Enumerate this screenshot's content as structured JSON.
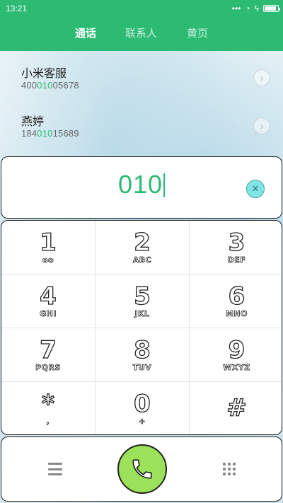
{
  "status_bar": {
    "time": "13:21",
    "icons": [
      "signal-dots-icon",
      "wifi-icon",
      "charging-icon",
      "battery-icon"
    ]
  },
  "tabs": [
    {
      "label": "通话",
      "active": true
    },
    {
      "label": "联系人",
      "active": false
    },
    {
      "label": "黄页",
      "active": false
    }
  ],
  "results": [
    {
      "name": "小米客服",
      "number_prefix": "400",
      "number_match": "010",
      "number_suffix": "05678"
    },
    {
      "name": "燕婷",
      "number_prefix": "184",
      "number_match": "010",
      "number_suffix": "15689"
    }
  ],
  "dial_input": {
    "value": "010"
  },
  "keypad": [
    {
      "digit": "1",
      "letters": "oo"
    },
    {
      "digit": "2",
      "letters": "ABC"
    },
    {
      "digit": "3",
      "letters": "DEF"
    },
    {
      "digit": "4",
      "letters": "GHI"
    },
    {
      "digit": "5",
      "letters": "JKL"
    },
    {
      "digit": "6",
      "letters": "MNO"
    },
    {
      "digit": "7",
      "letters": "PQRS"
    },
    {
      "digit": "8",
      "letters": "TUV"
    },
    {
      "digit": "9",
      "letters": "WXYZ"
    },
    {
      "digit": "*",
      "letters": ","
    },
    {
      "digit": "0",
      "letters": "+"
    },
    {
      "digit": "#",
      "letters": ""
    }
  ],
  "colors": {
    "accent": "#2dbb74",
    "call_button": "#9be25a",
    "delete_button": "#7fe6e6"
  }
}
